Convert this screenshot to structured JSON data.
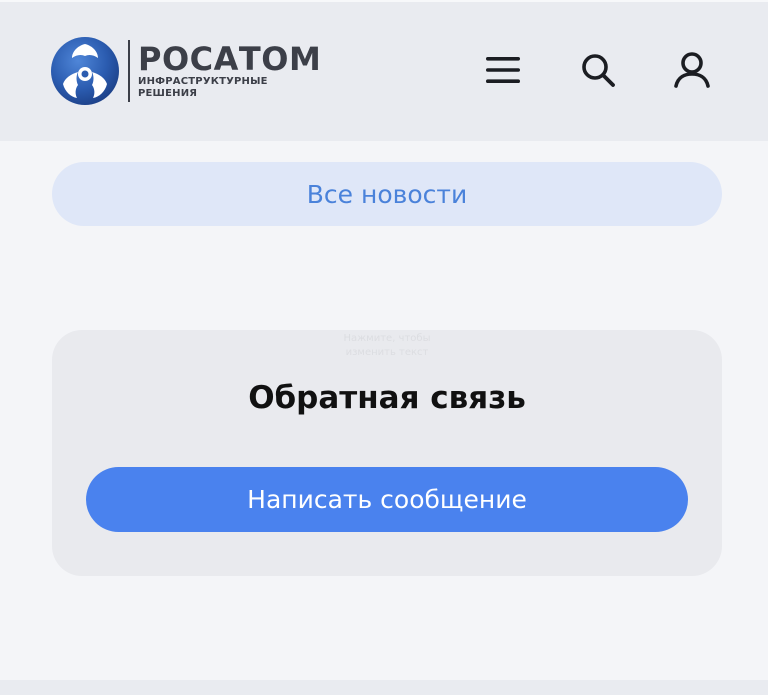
{
  "header": {
    "logo": {
      "title": "РОСАТОМ",
      "subtitle_line1": "ИНФРАСТРУКТУРНЫЕ",
      "subtitle_line2": "РЕШЕНИЯ",
      "icon": "rosatom-atom-logo"
    },
    "icons": {
      "menu": "hamburger-menu-icon",
      "search": "search-icon",
      "user": "user-icon"
    }
  },
  "all_news": {
    "label": "Все новости"
  },
  "feedback": {
    "ghost_hint": "Нажмите, чтобы изменить текст",
    "title": "Обратная связь",
    "button_label": "Написать сообщение"
  },
  "colors": {
    "header_bg": "#e9ebf0",
    "page_bg": "#f4f5f8",
    "accent": "#4a82ee",
    "pill_bg": "#dfe7f8",
    "pill_text": "#4a82da",
    "logo_text": "#3c3f48"
  }
}
